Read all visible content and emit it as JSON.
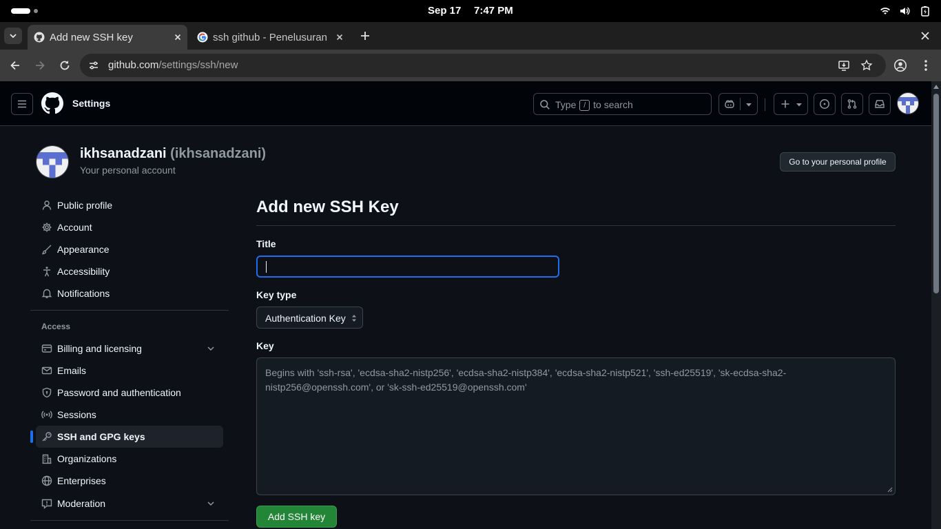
{
  "os": {
    "date": "Sep 17",
    "time": "7:47 PM"
  },
  "browser": {
    "tabs": [
      {
        "title": "Add new SSH key",
        "active": true
      },
      {
        "title": "ssh github - Penelusuran Google",
        "active": false
      }
    ],
    "url_host": "github.com",
    "url_path": "/settings/ssh/new"
  },
  "header": {
    "title": "Settings",
    "search_prefix": "Type",
    "search_key": "/",
    "search_suffix": "to search"
  },
  "context": {
    "name": "ikhsanadzani",
    "login": "(ikhsanadzani)",
    "subtitle": "Your personal account",
    "profile_button": "Go to your personal profile"
  },
  "sidebar": {
    "items": [
      {
        "label": "Public profile",
        "icon": "person-icon"
      },
      {
        "label": "Account",
        "icon": "gear-icon"
      },
      {
        "label": "Appearance",
        "icon": "paintbrush-icon"
      },
      {
        "label": "Accessibility",
        "icon": "accessibility-icon"
      },
      {
        "label": "Notifications",
        "icon": "bell-icon"
      }
    ],
    "access_heading": "Access",
    "access_items": [
      {
        "label": "Billing and licensing",
        "icon": "credit-card-icon",
        "expandable": true
      },
      {
        "label": "Emails",
        "icon": "mail-icon"
      },
      {
        "label": "Password and authentication",
        "icon": "shield-lock-icon"
      },
      {
        "label": "Sessions",
        "icon": "broadcast-icon"
      },
      {
        "label": "SSH and GPG keys",
        "icon": "key-icon",
        "selected": true
      },
      {
        "label": "Organizations",
        "icon": "organization-icon"
      },
      {
        "label": "Enterprises",
        "icon": "globe-icon"
      },
      {
        "label": "Moderation",
        "icon": "report-icon",
        "expandable": true
      }
    ]
  },
  "form": {
    "heading": "Add new SSH Key",
    "title_label": "Title",
    "title_value": "",
    "key_type_label": "Key type",
    "key_type_value": "Authentication Key",
    "key_label": "Key",
    "key_placeholder": "Begins with 'ssh-rsa', 'ecdsa-sha2-nistp256', 'ecdsa-sha2-nistp384', 'ecdsa-sha2-nistp521', 'ssh-ed25519', 'sk-ecdsa-sha2-nistp256@openssh.com', or 'sk-ssh-ed25519@openssh.com'",
    "submit_label": "Add SSH key"
  },
  "colors": {
    "accent": "#1f6feb",
    "primary_button": "#238636",
    "background": "#0d1117",
    "header_bg": "#010409"
  }
}
